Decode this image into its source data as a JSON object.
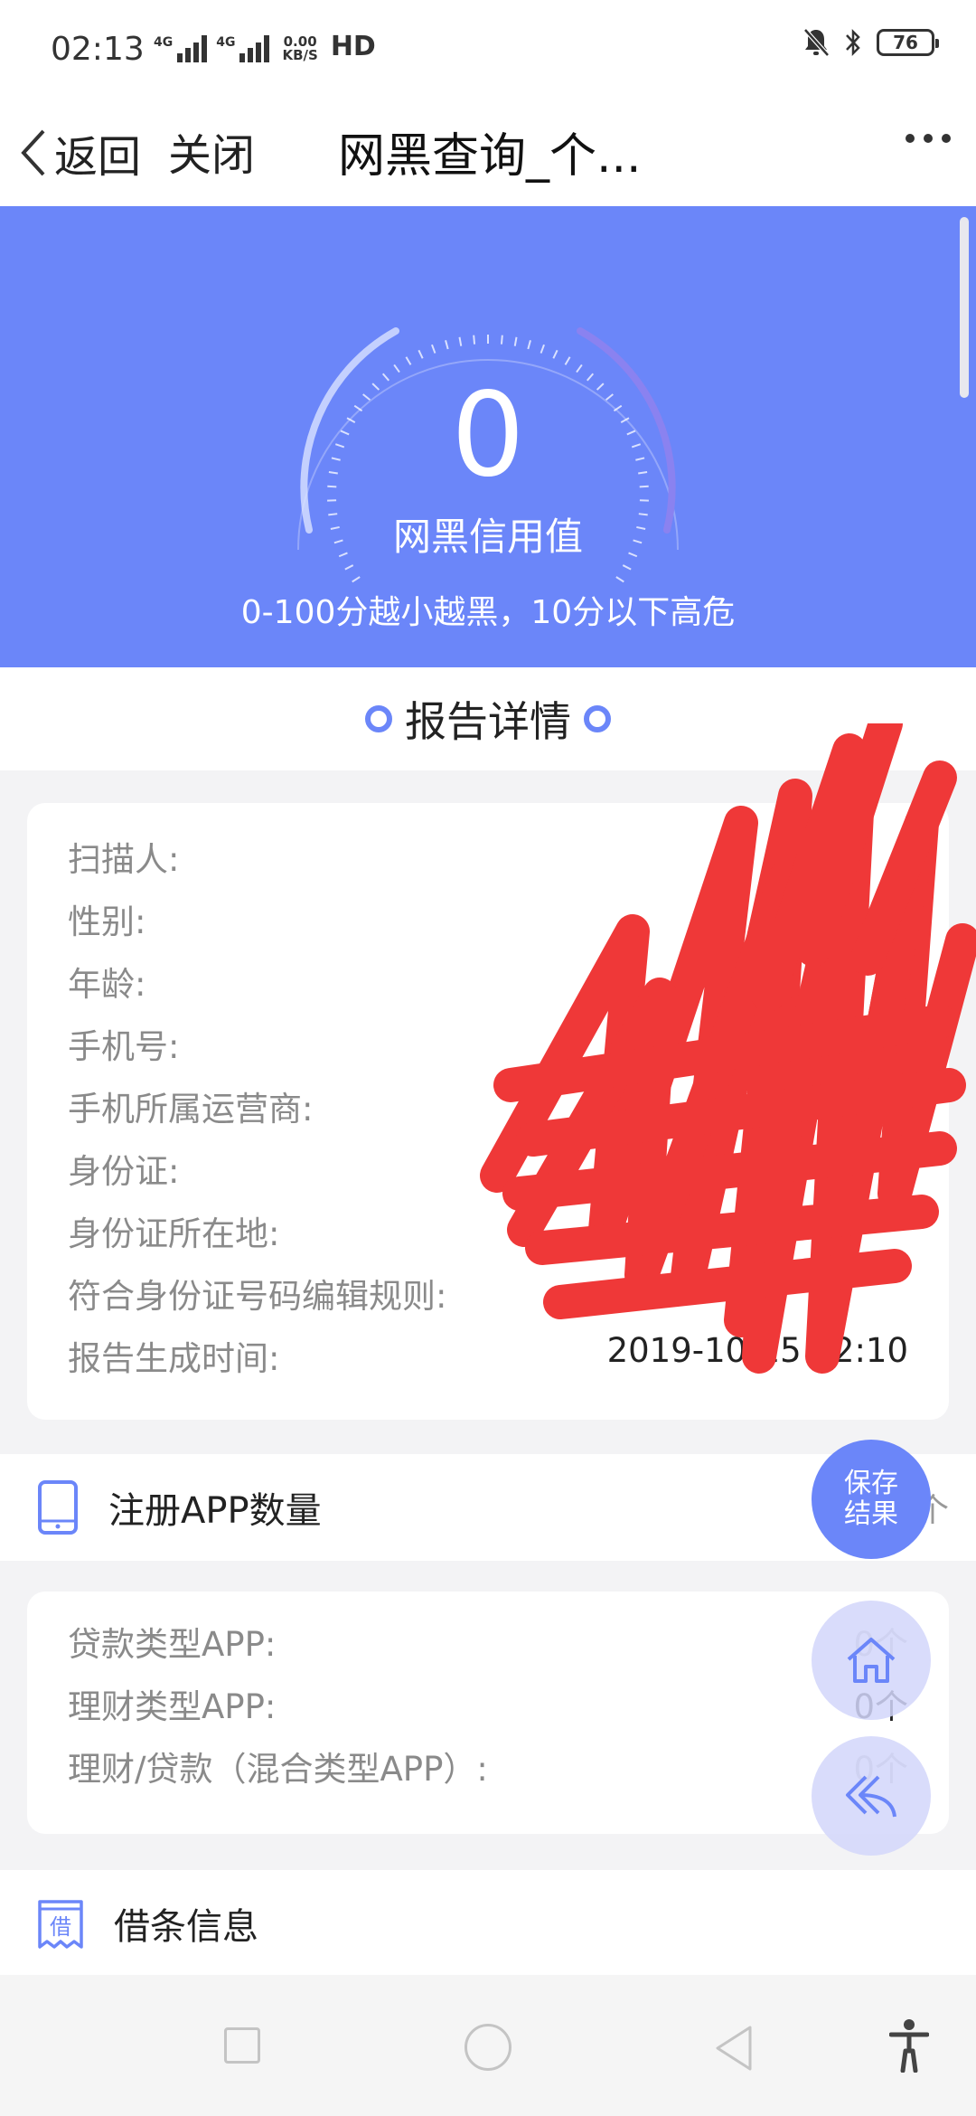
{
  "status_bar": {
    "time": "02:13",
    "signal_tag_1": "4G",
    "signal_tag_2": "4G",
    "speed_value": "0.00",
    "speed_unit": "KB/S",
    "hd_label": "HD",
    "battery": "76"
  },
  "nav": {
    "back_label": "返回",
    "close_label": "关闭",
    "title": "网黑查询_个..."
  },
  "hero": {
    "score": "0",
    "score_label": "网黑信用值",
    "note": "0-100分越小越黑，10分以下高危",
    "gauge_color": "#6b86f9"
  },
  "report": {
    "title": "报告详情",
    "rows": [
      {
        "label": "扫描人:"
      },
      {
        "label": "性别:"
      },
      {
        "label": "年龄:"
      },
      {
        "label": "手机号:"
      },
      {
        "label": "手机所属运营商:"
      },
      {
        "label": "身份证:"
      },
      {
        "label": "身份证所在地:"
      },
      {
        "label": "符合身份证号码编辑规则:"
      },
      {
        "label": "报告生成时间:",
        "value": "2019-10-15 02:10"
      }
    ]
  },
  "app_count": {
    "title": "注册APP数量",
    "total": "总计0个"
  },
  "app_types": [
    {
      "label": "贷款类型APP:",
      "value": "0个"
    },
    {
      "label": "理财类型APP:",
      "value": "0个"
    },
    {
      "label": "理财/贷款（混合类型APP）:",
      "value": "0个"
    }
  ],
  "loan_note": {
    "title": "借条信息",
    "icon_char": "借"
  },
  "fab": {
    "save_line1": "保存",
    "save_line2": "结果"
  },
  "colors": {
    "accent": "#6b86f9",
    "redaction": "#ef3838"
  }
}
